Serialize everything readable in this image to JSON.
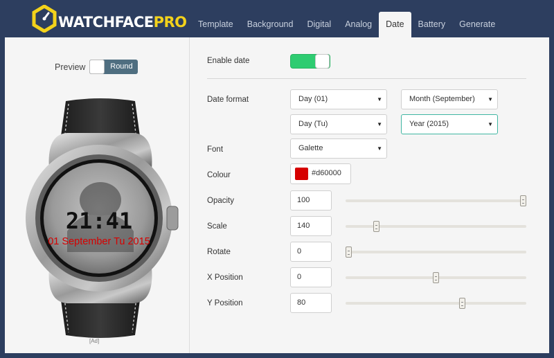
{
  "brand": {
    "part1": "WATCHFACE",
    "part2": "PRO"
  },
  "nav": {
    "tabs": [
      {
        "label": "Template"
      },
      {
        "label": "Background"
      },
      {
        "label": "Digital"
      },
      {
        "label": "Analog"
      },
      {
        "label": "Date",
        "active": true
      },
      {
        "label": "Battery"
      },
      {
        "label": "Generate"
      }
    ]
  },
  "preview": {
    "label": "Preview",
    "shape_value": "Round",
    "watch_time": "21:41",
    "watch_date": "01 September Tu 2015",
    "note": "[Ad]"
  },
  "date_settings": {
    "enable_label": "Enable date",
    "enabled": true,
    "format_label": "Date format",
    "format_day_num": "Day (01)",
    "format_month": "Month (September)",
    "format_day_name": "Day (Tu)",
    "format_year": "Year (2015)",
    "font_label": "Font",
    "font_value": "Galette",
    "colour_label": "Colour",
    "colour_value": "#d60000",
    "opacity_label": "Opacity",
    "opacity_value": "100",
    "scale_label": "Scale",
    "scale_value": "140",
    "rotate_label": "Rotate",
    "rotate_value": "0",
    "xpos_label": "X Position",
    "xpos_value": "0",
    "ypos_label": "Y Position",
    "ypos_value": "80"
  },
  "colors": {
    "header_bg": "#2d3e5f",
    "accent_yellow": "#f3d21b",
    "switch_green": "#2ecc71",
    "date_red": "#d60000"
  }
}
